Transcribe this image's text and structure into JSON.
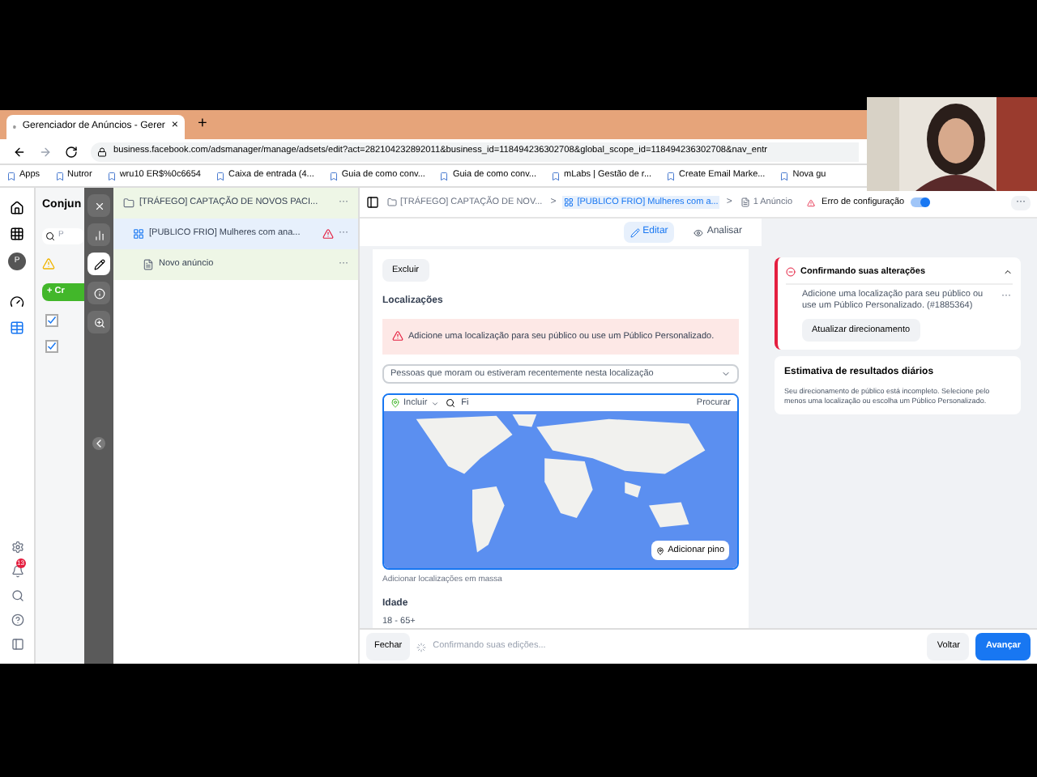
{
  "browser": {
    "tab": {
      "title": "Gerenciador de Anúncios - Gerer",
      "close": "×"
    },
    "new_tab": "+",
    "url": "business.facebook.com/adsmanager/manage/adsets/edit?act=282104232892011&business_id=118494236302708&global_scope_id=118494236302708&nav_entr",
    "bookmarks": [
      "Apps",
      "Nutror",
      "wru10 ER$%0c6654",
      "Caixa de entrada (4...",
      "Guia de como conv...",
      "Guia de como conv...",
      "mLabs | Gestão de r...",
      "Create Email Marke...",
      "Nova gu"
    ]
  },
  "campaigns_panel": {
    "title": "Conjun",
    "search_placeholder": "P",
    "create": "+ Cr",
    "rows": [
      {
        "checked": true
      },
      {
        "checked": true
      }
    ]
  },
  "notifications": {
    "count": "13"
  },
  "avatar": "P",
  "tools": [
    {
      "kind": "close",
      "selected": false
    },
    {
      "kind": "chart",
      "selected": false
    },
    {
      "kind": "edit",
      "selected": true
    },
    {
      "kind": "info",
      "selected": false
    },
    {
      "kind": "zoom",
      "selected": false
    }
  ],
  "tree": [
    {
      "kind": "campaign",
      "label": "[TRÁFEGO] CAPTAÇÃO DE NOVOS PACI...",
      "selected": false,
      "error": false,
      "more": "···"
    },
    {
      "kind": "adset",
      "label": "[PUBLICO FRIO] Mulheres com ana...",
      "selected": true,
      "error": true,
      "more": "···"
    },
    {
      "kind": "ad",
      "label": "Novo anúncio",
      "selected": false,
      "error": false,
      "more": "···"
    }
  ],
  "breadcrumb": {
    "items": [
      {
        "kind": "campaign",
        "label": "[TRÁFEGO] CAPTAÇÃO DE NOV..."
      },
      {
        "kind": "adset",
        "label": "[PUBLICO FRIO] Mulheres com a..."
      },
      {
        "kind": "ad",
        "label": "1 Anúncio"
      }
    ],
    "separator": ">",
    "status": "Erro de configuração",
    "on": true,
    "more": "···"
  },
  "mode_tabs": [
    {
      "label": "Editar",
      "selected": true
    },
    {
      "label": "Analisar",
      "selected": false
    }
  ],
  "editor": {
    "delete": "Excluir",
    "section": "Localizações",
    "alert": "Adicione uma localização para seu público ou use um Público Personalizado.",
    "location_type": "Pessoas que moram ou estiveram recentemente nesta localização",
    "include": "Incluir",
    "search_value": "Fi",
    "search_button": "Procurar",
    "add_pin": "Adicionar pino",
    "bulk": "Adicionar localizações em massa",
    "age_label": "Idade",
    "age_value": "18 - 65+"
  },
  "confirm_card": {
    "title": "Confirmando suas alterações",
    "message": "Adicione uma localização para seu público ou use um Público Personalizado. (#1885364)",
    "more": "···",
    "button": "Atualizar direcionamento"
  },
  "estimate_card": {
    "title": "Estimativa de resultados diários",
    "text": "Seu direcionamento de público está incompleto. Selecione pelo menos uma localização ou escolha um Público Personalizado."
  },
  "footer": {
    "close": "Fechar",
    "status": "Confirmando suas edições...",
    "back": "Voltar",
    "next": "Avançar"
  }
}
